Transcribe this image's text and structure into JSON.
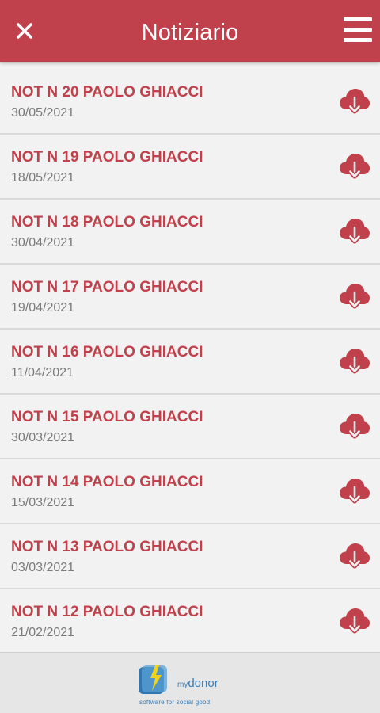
{
  "header": {
    "title": "Notiziario",
    "close_icon": "close-icon",
    "menu_icon": "hamburger-menu-icon",
    "background_color": "#c0404b"
  },
  "items": [
    {
      "title": "NOT N 20 PAOLO GHIACCI",
      "date": "30/05/2021"
    },
    {
      "title": "NOT N 19 PAOLO GHIACCI",
      "date": "18/05/2021"
    },
    {
      "title": "NOT N 18 PAOLO GHIACCI",
      "date": "30/04/2021"
    },
    {
      "title": "NOT N 17 PAOLO GHIACCI",
      "date": "19/04/2021"
    },
    {
      "title": "NOT N 16 PAOLO GHIACCI",
      "date": "11/04/2021"
    },
    {
      "title": "NOT N 15 PAOLO GHIACCI",
      "date": "30/03/2021"
    },
    {
      "title": "NOT N 14 PAOLO GHIACCI",
      "date": "15/03/2021"
    },
    {
      "title": "NOT N 13 PAOLO GHIACCI",
      "date": "03/03/2021"
    },
    {
      "title": "NOT N 12 PAOLO GHIACCI",
      "date": "21/02/2021"
    }
  ],
  "item_action_icon": "cloud-download-icon",
  "footer": {
    "logo_my": "my",
    "logo_name": "donor",
    "logo_tagline": "software for social good"
  },
  "colors": {
    "accent": "#c0404b",
    "date_text": "#7a7a7a",
    "background": "#f2f2f2",
    "logo_blue": "#3a7db5"
  }
}
